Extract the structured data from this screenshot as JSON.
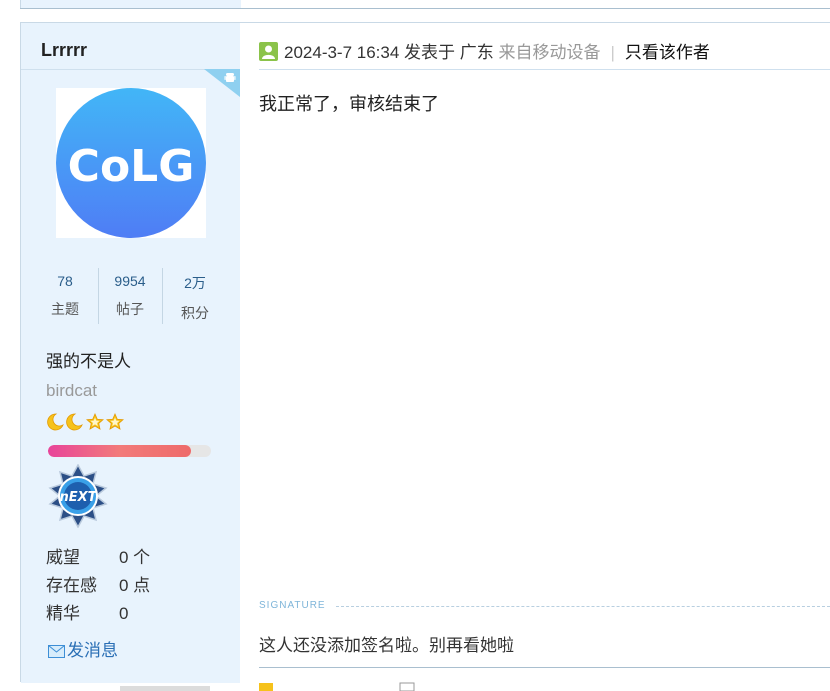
{
  "author": {
    "name": "Lrrrrr",
    "avatar_text": "CoLG",
    "stats": [
      {
        "value": "78",
        "label": "主题"
      },
      {
        "value": "9954",
        "label": "帖子"
      },
      {
        "value": "2万",
        "label": "积分"
      }
    ],
    "group_title": "强的不是人",
    "custom_title": "birdcat",
    "level_progress": 0.88,
    "medal_text": "nEXT",
    "info": [
      {
        "key": "威望",
        "value": "0 个"
      },
      {
        "key": "存在感",
        "value": "0 点"
      },
      {
        "key": "精华",
        "value": "0"
      }
    ],
    "pm_label": "发消息"
  },
  "post": {
    "timestamp": "2024-3-7 16:34 发表于 广东",
    "from_device": "来自移动设备",
    "separator": "|",
    "only_author_label": "只看该作者",
    "content": "我正常了，审核结束了",
    "signature_label": "SIGNATURE",
    "signature_text": "这人还没添加签名啦。别再看她啦"
  },
  "colors": {
    "sidebar_bg": "#e8f3fd",
    "link": "#2a6fb5",
    "avatar_blue": "#4a8ff5",
    "progress_pink": "#e8449a"
  }
}
